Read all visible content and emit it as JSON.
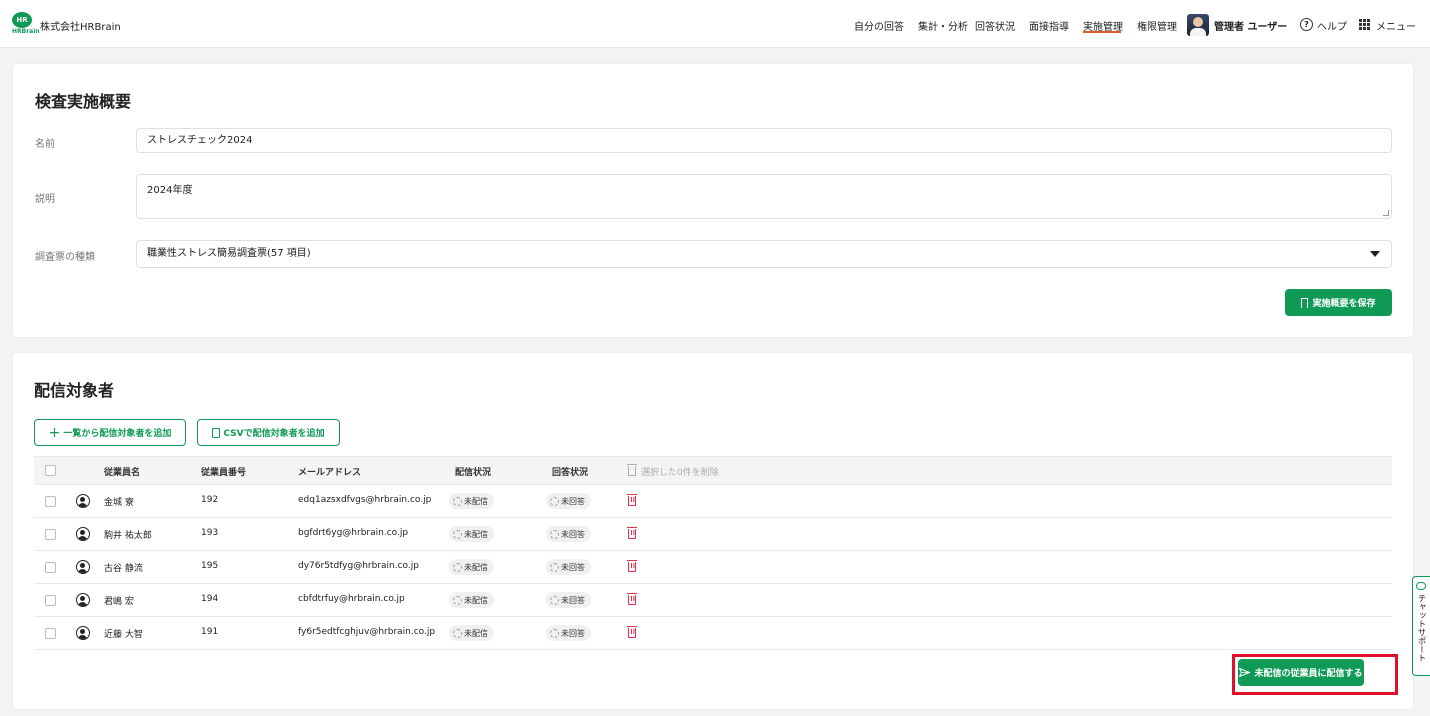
{
  "header": {
    "logo_main": "HR",
    "logo_sub": "HRBrain",
    "company": "株式会社HRBrain",
    "nav": [
      "自分の回答",
      "集計・分析",
      "回答状況",
      "面接指導",
      "実施管理",
      "権限管理"
    ],
    "active_nav": "実施管理",
    "user": "管理者 ユーザー",
    "help": "ヘルプ",
    "help_icon_glyph": "?",
    "menu": "メニュー"
  },
  "overview": {
    "title": "検査実施概要",
    "name_label": "名前",
    "name_value": "ストレスチェック2024",
    "desc_label": "説明",
    "desc_value": "2024年度",
    "type_label": "調査票の種類",
    "type_value": "職業性ストレス簡易調査票(57 項目)",
    "save_button": "実施概要を保存"
  },
  "targets": {
    "title": "配信対象者",
    "add_from_list": "一覧から配信対象者を追加",
    "add_from_csv": "CSVで配信対象者を追加",
    "plus_glyph": "+",
    "columns": {
      "name": "従業員名",
      "number": "従業員番号",
      "email": "メールアドレス",
      "delivery": "配信状況",
      "answer": "回答状況",
      "delete_selected": "選択した0件を削除"
    },
    "rows": [
      {
        "name": "金城 寮",
        "number": "192",
        "email": "edq1azsxdfvgs@hrbrain.co.jp",
        "delivery": "未配信",
        "answer": "未回答"
      },
      {
        "name": "駒井 祐太郎",
        "number": "193",
        "email": "bgfdrt6yg@hrbrain.co.jp",
        "delivery": "未配信",
        "answer": "未回答"
      },
      {
        "name": "古谷 静流",
        "number": "195",
        "email": "dy76r5tdfyg@hrbrain.co.jp",
        "delivery": "未配信",
        "answer": "未回答"
      },
      {
        "name": "君嶋 宏",
        "number": "194",
        "email": "cbfdtrfuy@hrbrain.co.jp",
        "delivery": "未配信",
        "answer": "未回答"
      },
      {
        "name": "近藤 大智",
        "number": "191",
        "email": "fy6r5edtfcghjuv@hrbrain.co.jp",
        "delivery": "未配信",
        "answer": "未回答"
      }
    ],
    "deliver_button": "未配信の従業員に配信する"
  },
  "chat_support": "チャットサポート",
  "colors": {
    "brand_green": "#0f9a56",
    "active_underline": "#e25a2b",
    "delete_red": "#e0304a",
    "highlight_red": "#e0102a"
  }
}
